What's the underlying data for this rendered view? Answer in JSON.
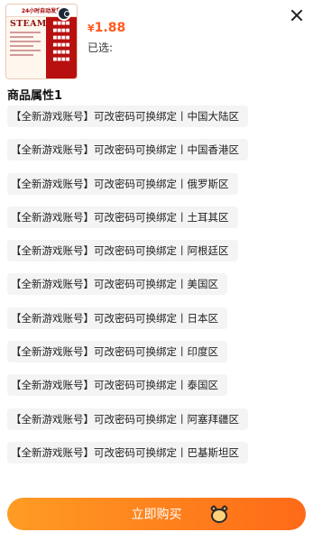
{
  "product": {
    "thumbnail": {
      "top_text": "24小时自动发货",
      "brand": "STEAM",
      "icon": "steam-logo-icon"
    },
    "price_currency": "¥",
    "price_value": "1.88",
    "selected_label": "已选:"
  },
  "attribute_section": {
    "title": "商品属性1",
    "options": [
      "【全新游戏账号】可改密码可换绑定丨中国大陆区",
      "【全新游戏账号】可改密码可换绑定丨中国香港区",
      "【全新游戏账号】可改密码可换绑定丨俄罗斯区",
      "【全新游戏账号】可改密码可换绑定丨土耳其区",
      "【全新游戏账号】可改密码可换绑定丨阿根廷区",
      "【全新游戏账号】可改密码可换绑定丨美国区",
      "【全新游戏账号】可改密码可换绑定丨日本区",
      "【全新游戏账号】可改密码可换绑定丨印度区",
      "【全新游戏账号】可改密码可换绑定丨泰国区",
      "【全新游戏账号】可改密码可换绑定丨阿塞拜疆区",
      "【全新游戏账号】可改密码可换绑定丨巴基斯坦区"
    ]
  },
  "buy_button": {
    "label": "立即购买"
  },
  "icons": {
    "close": "close-icon",
    "mascot": "mascot-watermark-icon"
  },
  "colors": {
    "accent": "#ff5a1f",
    "button_start": "#ff9c23",
    "button_end": "#ff6a18",
    "option_bg": "#f4f4f4"
  }
}
